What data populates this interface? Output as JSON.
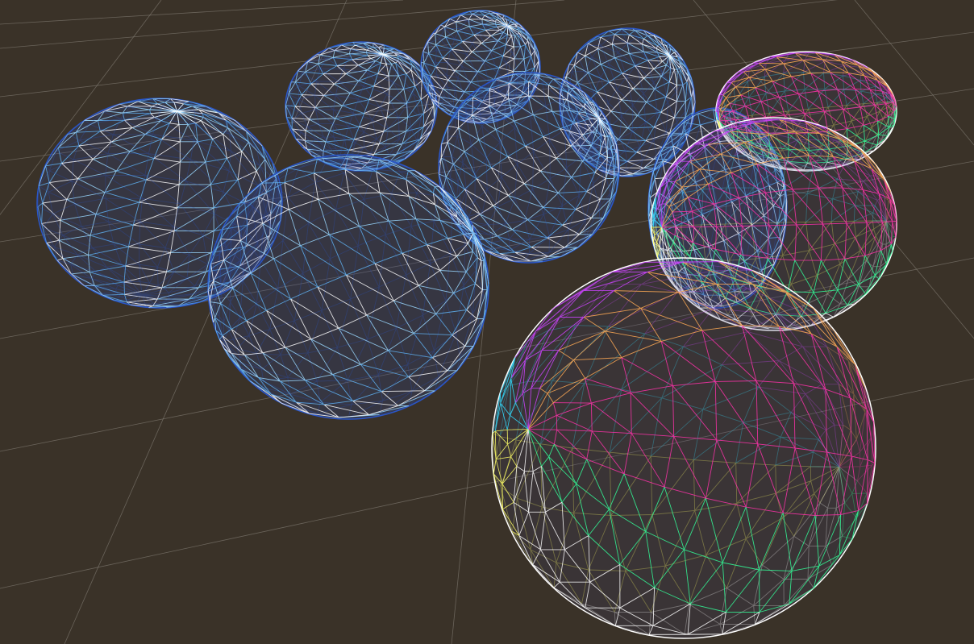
{
  "scene": {
    "background_color": "#3a3228",
    "grid_color": "#8a857c",
    "grid_visible": true,
    "render_mode": "wireframe",
    "object_count": 10
  },
  "spheres": [
    {
      "id": "blue-sphere-1",
      "palette": "blue"
    },
    {
      "id": "blue-sphere-2",
      "palette": "blue"
    },
    {
      "id": "blue-sphere-3",
      "palette": "blue"
    },
    {
      "id": "blue-sphere-4",
      "palette": "blue"
    },
    {
      "id": "blue-sphere-5",
      "palette": "blue"
    },
    {
      "id": "blue-sphere-6",
      "palette": "blue"
    },
    {
      "id": "blue-sphere-7",
      "palette": "blue"
    },
    {
      "id": "colored-sphere-1",
      "palette": "rainbow"
    },
    {
      "id": "colored-sphere-2",
      "palette": "rainbow"
    },
    {
      "id": "colored-sphere-3",
      "palette": "rainbow"
    }
  ],
  "palettes": {
    "blue": [
      "#2a56c8",
      "#3d7fe0",
      "#5fb0f0",
      "#9ad8ff",
      "#ffffff"
    ],
    "rainbow": [
      "#ffff66",
      "#ffffff",
      "#33ff99",
      "#ff33aa",
      "#ffaa55",
      "#cc44ff",
      "#33ddff"
    ]
  }
}
